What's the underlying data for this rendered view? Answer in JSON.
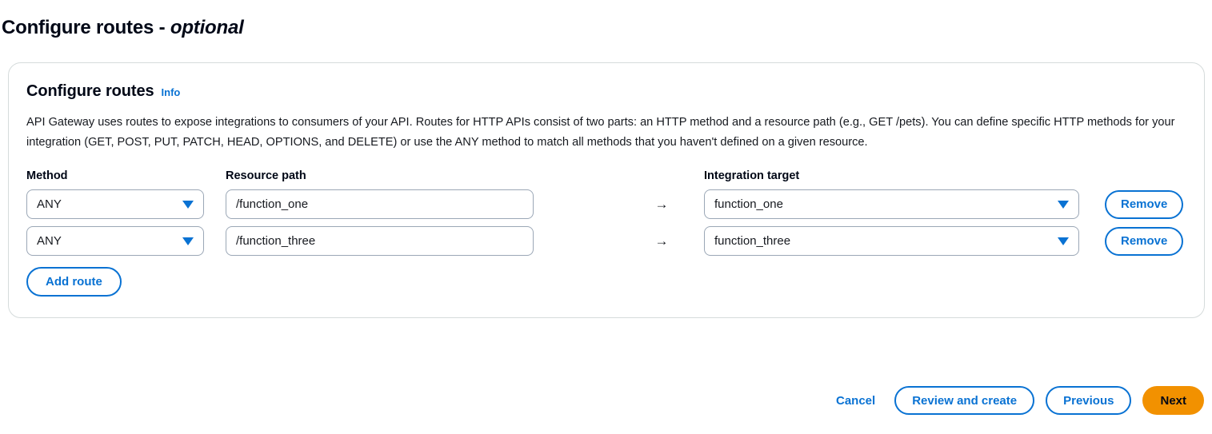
{
  "page": {
    "title_main": "Configure routes",
    "title_separator": " - ",
    "title_optional": "optional"
  },
  "card": {
    "title": "Configure routes",
    "info_label": "Info",
    "description": "API Gateway uses routes to expose integrations to consumers of your API. Routes for HTTP APIs consist of two parts: an HTTP method and a resource path (e.g., GET /pets). You can define specific HTTP methods for your integration (GET, POST, PUT, PATCH, HEAD, OPTIONS, and DELETE) or use the ANY method to match all methods that you haven't defined on a given resource."
  },
  "table": {
    "headers": {
      "method": "Method",
      "resource_path": "Resource path",
      "integration_target": "Integration target"
    },
    "arrow_glyph": "→",
    "rows": [
      {
        "method": "ANY",
        "resource_path": "/function_one",
        "integration_target": "function_one",
        "remove_label": "Remove"
      },
      {
        "method": "ANY",
        "resource_path": "/function_three",
        "integration_target": "function_three",
        "remove_label": "Remove"
      }
    ],
    "add_route_label": "Add route"
  },
  "footer": {
    "cancel": "Cancel",
    "review_and_create": "Review and create",
    "previous": "Previous",
    "next": "Next"
  },
  "colors": {
    "link_blue": "#0972d3",
    "primary_orange": "#f29100",
    "border_gray": "#d5dbdb",
    "field_border": "#9ba7b6",
    "text": "#16191f"
  }
}
